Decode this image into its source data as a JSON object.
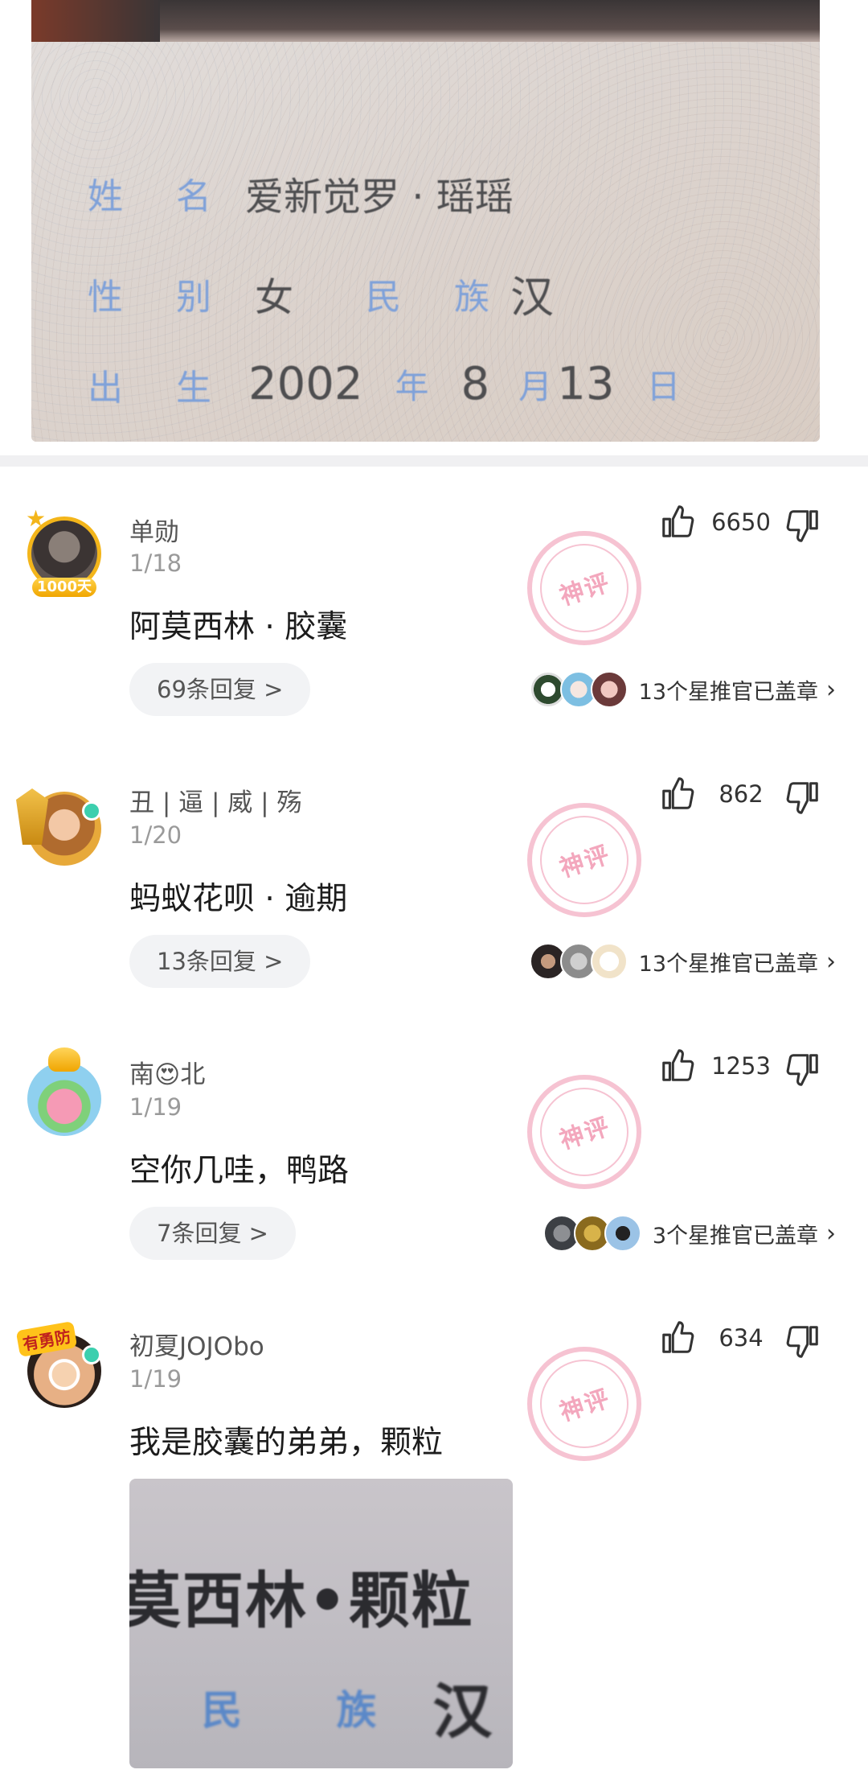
{
  "id_card": {
    "name_label": "姓 名",
    "name_value": "爱新觉罗 · 瑶瑶",
    "gender_label": "性 别",
    "gender_value": "女",
    "ethnic_label": "民 族",
    "ethnic_value": "汉",
    "birth_label": "出 生",
    "birth_year": "2002",
    "year_unit": "年",
    "birth_month": "8",
    "month_unit": "月",
    "birth_day": "13",
    "day_unit": "日"
  },
  "watermark_text": "神评",
  "comments": [
    {
      "username": "单勋",
      "date": "1/18",
      "text": "阿莫西林 · 胶囊",
      "likes": "6650",
      "replies": "69条回复 >",
      "stamp_text": "13个星推官已盖章",
      "avatar_badge": "1000天"
    },
    {
      "username": "丑 | 逼 | 威 | 殇",
      "date": "1/20",
      "text": "蚂蚁花呗 · 逾期",
      "likes": "862",
      "replies": "13条回复 >",
      "stamp_text": "13个星推官已盖章"
    },
    {
      "username_pre": "南",
      "username_emoji": "😍",
      "username_post": "北",
      "date": "1/19",
      "text": "空你几哇，鸭路",
      "likes": "1253",
      "replies": "7条回复 >",
      "stamp_text": "3个星推官已盖章"
    },
    {
      "username": "初夏JOJObo",
      "date": "1/19",
      "text": "我是胶囊的弟弟，颗粒",
      "likes": "634",
      "avatar_badge": "有勇防",
      "image": {
        "line1": "莫西林•颗粒",
        "label": "民 族",
        "value": "汉"
      }
    }
  ],
  "icons": {
    "like": "thumbs-up-icon",
    "dislike": "thumbs-down-icon",
    "chevron": "chevron-right-icon"
  },
  "colors": {
    "online_dot": "#3ccfae",
    "watermark": "#f3a7bd",
    "reply_pill": "#f2f3f5",
    "id_label_blue": "#7fa1d9"
  }
}
